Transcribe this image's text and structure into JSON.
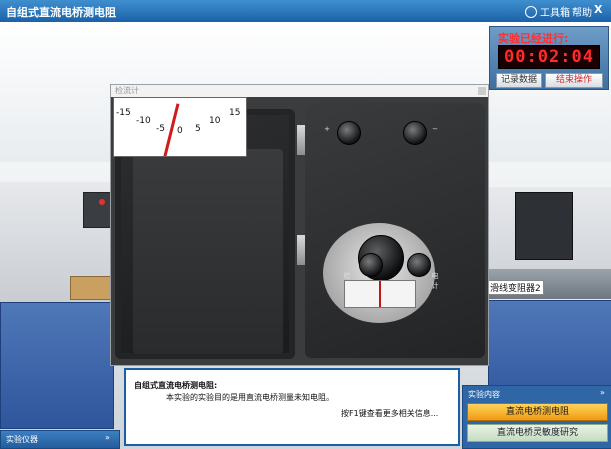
{
  "window": {
    "title": "自组式直流电桥测电阻",
    "toolbox_label": "工具箱",
    "help_label": "帮助",
    "close_label": "X"
  },
  "timer": {
    "label": "实验已经进行:",
    "value": "00:02:04",
    "record_button": "记录数据",
    "end_button": "结束操作"
  },
  "galvanometer_window": {
    "title": "检流计",
    "scale_labels": [
      "-15",
      "-10",
      "-5",
      "0",
      "5",
      "10",
      "15"
    ],
    "knob_labels": [
      "G",
      "B",
      "检",
      "电计"
    ]
  },
  "scene": {
    "rail_label": "滑线变阻器2"
  },
  "info": {
    "title": "自组式直流电桥测电阻:",
    "body": "本实验的实验目的是用直流电桥测量未知电阻。",
    "hint": "按F1键查看更多相关信息..."
  },
  "content_panel": {
    "header": "实验内容",
    "items": [
      "直流电桥测电阻",
      "直流电桥灵敏度研究"
    ],
    "chevron": "»"
  },
  "instruments_panel": {
    "title": "实验仪器",
    "chevron": "»"
  },
  "colors": {
    "titlebar": "#1b62a8",
    "timer_digits": "#ff2a2a",
    "active_item": "#f19a13"
  }
}
